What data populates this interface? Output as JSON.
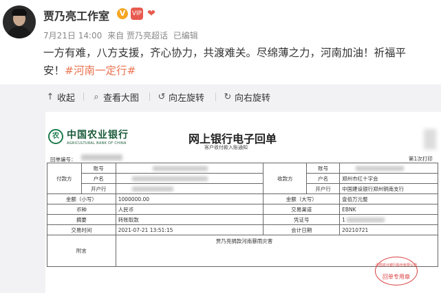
{
  "post": {
    "author": "贾乃亮工作室",
    "badge_v": "V",
    "meta_date": "7月21日 14:00",
    "meta_source": "来自 贾乃亮超话",
    "meta_edited": "已编辑",
    "content_line1": "一方有难，八方支援，齐心协力，共渡难关。尽绵薄之力，河南加油！祈福平",
    "content_line2": "安！",
    "hashtag": "#河南一定行#"
  },
  "toolbar": {
    "collapse_label": "收起",
    "view_large_label": "查看大图",
    "rotate_left_label": "向左旋转",
    "rotate_right_label": "向右旋转"
  },
  "receipt": {
    "bank_logo_text": "农",
    "bank_name_cn": "中国农业银行",
    "bank_name_en": "AGRICULTURAL BANK OF CHINA",
    "title": "网上银行电子回单",
    "subtitle": "客户收付款入账通知",
    "receipt_no_label": "回单编号：",
    "page_label": "第1次打印",
    "payer_label": "付款方",
    "payee_label": "收款方",
    "account_no_label": "账号",
    "account_name_label": "户名",
    "bank_label": "开户行",
    "payee_account_name": "郑州市红十字会",
    "payee_bank": "中国建设银行郑州铜南支行",
    "amount_lower_label": "金额（小写）",
    "amount_lower_value": "1000000.00",
    "amount_upper_label": "金额（大写）",
    "amount_upper_value": "壹佰万元整",
    "currency_label": "币种",
    "currency_value": "人民币",
    "channel_label": "交易渠道",
    "channel_value": "EBNK",
    "summary_label": "摘要",
    "summary_value": "转账取款",
    "voucher_label": "凭证号",
    "voucher_value": "1",
    "time_label": "交易时间",
    "time_value": "2021-07-21 13:51:15",
    "accounting_date_label": "会计日期",
    "accounting_date_value": "20210721",
    "note_label": "附言",
    "note_value": "贾乃亮捐款河南暴雨灾害",
    "stamp_text_top": "中国农业银行股份有限公司",
    "stamp_text_bottom": "回单专用章"
  }
}
